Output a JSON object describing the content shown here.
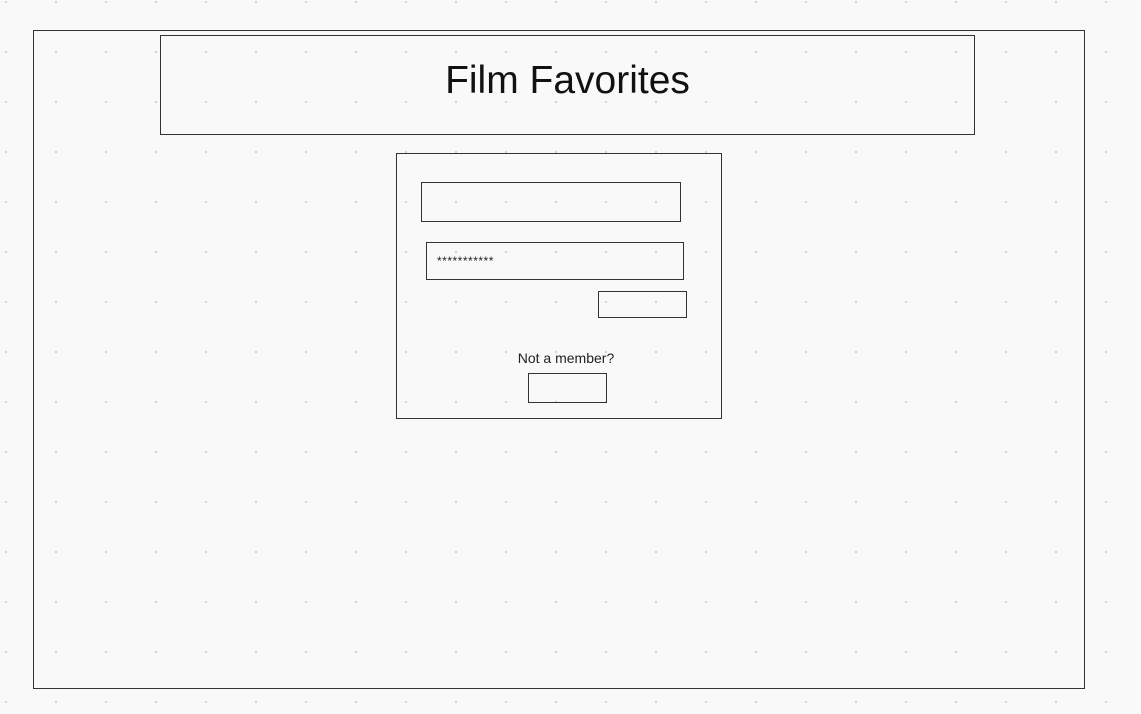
{
  "header": {
    "title": "Film Favorites"
  },
  "login": {
    "username_value": "",
    "password_value": "***********",
    "login_button_label": "",
    "not_member_text": "Not a member?",
    "signup_button_label": ""
  }
}
